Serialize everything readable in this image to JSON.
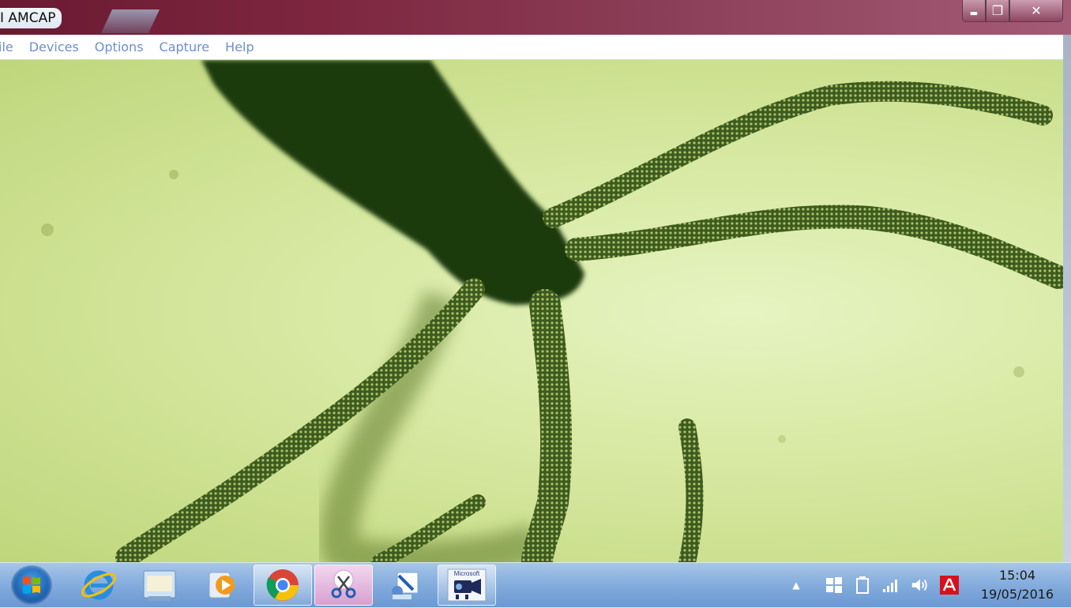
{
  "window": {
    "title": "AMCAP",
    "title_prefix": "I"
  },
  "controls": {
    "minimize": "▬",
    "maximize": "❐",
    "close": "✕"
  },
  "menu": {
    "items": [
      "ile",
      "Devices",
      "Options",
      "Capture",
      "Help"
    ]
  },
  "taskbar": {
    "apps": [
      {
        "name": "Internet Explorer",
        "icon": "internet-explorer-icon"
      },
      {
        "name": "Windows Explorer",
        "icon": "folder-icon"
      },
      {
        "name": "Windows Media Player",
        "icon": "media-player-icon"
      },
      {
        "name": "Google Chrome",
        "icon": "chrome-icon"
      },
      {
        "name": "Snipping Tool",
        "icon": "scissors-icon"
      },
      {
        "name": "Paint",
        "icon": "paint-icon"
      },
      {
        "name": "AMCAP",
        "icon": "camera-icon"
      }
    ],
    "amcap_badge": "Microsoft",
    "tray": {
      "time": "15:04",
      "date": "19/05/2016"
    }
  },
  "colors": {
    "menu_text": "#6c8fd0",
    "titlebar": "#7e2640",
    "taskbar": "#86aede"
  }
}
